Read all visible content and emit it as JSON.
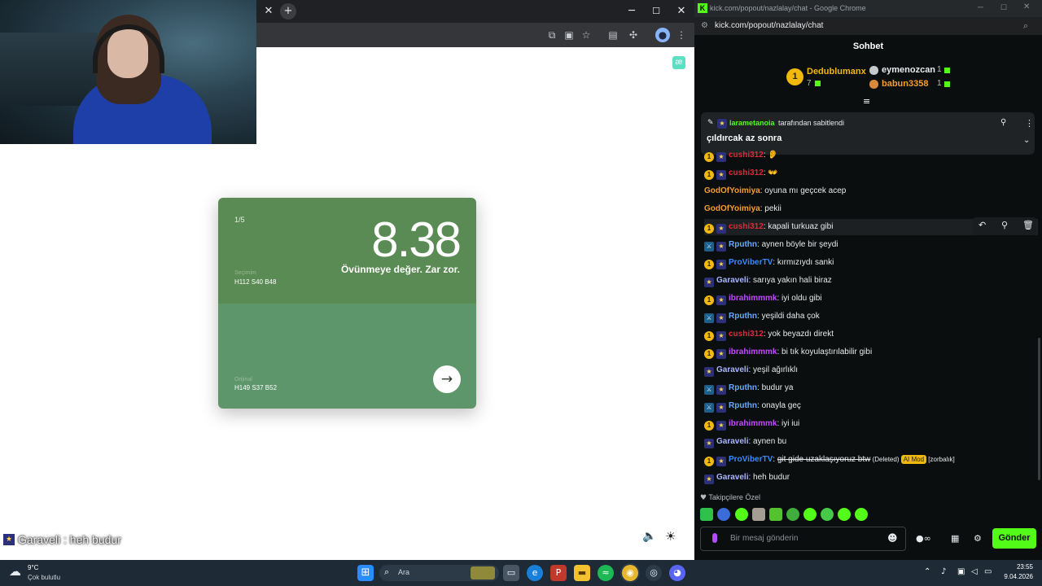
{
  "left_browser": {
    "tab_close": "✕",
    "new_tab": "+",
    "controls": {
      "minimize": "─",
      "maximize": "☐",
      "close": "✕"
    },
    "toolbar_icons": [
      "translate-icon",
      "screenshot-icon",
      "bookmark-star-icon",
      "reader-icon",
      "extensions-icon",
      "profile-icon",
      "menu-icon"
    ],
    "extension_badge": "æ"
  },
  "card": {
    "counter": "1/5",
    "score": "8.38",
    "remark": "Övünmeye değer. Zar zor.",
    "yours_label": "Seçimim",
    "yours_value": "H112 S40 B48",
    "original_label": "Orijinal",
    "original_value": "H149 S37 B52",
    "next_arrow": "→",
    "colors": {
      "top": "#5b8b54",
      "bottom": "#5c966a"
    }
  },
  "bottom_controls": {
    "sound_icon": "🔈",
    "theme_icon": "☀"
  },
  "overlay_caption": "Garaveli : heh budur",
  "chat_window": {
    "title": "kick.com/popout/nazlalay/chat - Google Chrome",
    "url": "kick.com/popout/nazlalay/chat",
    "header": "Sohbet",
    "leaderboard": {
      "first": {
        "rank": "1",
        "name": "Dedublumanx",
        "count": "7"
      },
      "second": {
        "name": "eymenozcan",
        "count": "1"
      },
      "third": {
        "name": "babun3358",
        "count": "1"
      }
    },
    "pinned": {
      "by_user": "larametanoia",
      "by_text": "tarafından sabitlendi",
      "message": "çıldırcak az sonra"
    },
    "messages": [
      {
        "badges": [
          "1",
          "star"
        ],
        "user": "cushi312",
        "color": "#e5273b",
        "text": "👂"
      },
      {
        "badges": [
          "1",
          "star"
        ],
        "user": "cushi312",
        "color": "#e5273b",
        "text": "👐"
      },
      {
        "badges": [],
        "user": "GodOfYoimiya",
        "color": "#f59e2d",
        "text": "oyuna mı geçcek acep"
      },
      {
        "badges": [],
        "user": "GodOfYoimiya",
        "color": "#f59e2d",
        "text": "pekii"
      },
      {
        "badges": [
          "1",
          "star"
        ],
        "user": "cushi312",
        "color": "#e5273b",
        "text": "kapali turkuaz gibi"
      },
      {
        "badges": [
          "mod",
          "star"
        ],
        "user": "Rputhn",
        "color": "#6aa8ff",
        "text": "aynen böyle bir şeydi"
      },
      {
        "badges": [
          "1",
          "star"
        ],
        "user": "ProViberTV",
        "color": "#3a8bff",
        "text": "kırmızıydı sanki"
      },
      {
        "badges": [
          "star"
        ],
        "user": "Garaveli",
        "color": "#aab6ff",
        "text": "sarıya yakın hali biraz"
      },
      {
        "badges": [
          "1",
          "star"
        ],
        "user": "ibrahimmmk",
        "color": "#c04bff",
        "text": "iyi oldu gibi"
      },
      {
        "badges": [
          "mod",
          "star"
        ],
        "user": "Rputhn",
        "color": "#6aa8ff",
        "text": "yeşildi daha çok"
      },
      {
        "badges": [
          "1",
          "star"
        ],
        "user": "cushi312",
        "color": "#e5273b",
        "text": "yok beyazdı direkt"
      },
      {
        "badges": [
          "1",
          "star"
        ],
        "user": "ibrahimmmk",
        "color": "#c04bff",
        "text": "bi tık koyulaştırılabilir gibi"
      },
      {
        "badges": [
          "star"
        ],
        "user": "Garaveli",
        "color": "#aab6ff",
        "text": "yeşil ağırlıklı"
      },
      {
        "badges": [
          "mod",
          "star"
        ],
        "user": "Rputhn",
        "color": "#6aa8ff",
        "text": "budur ya"
      },
      {
        "badges": [
          "mod",
          "star"
        ],
        "user": "Rputhn",
        "color": "#6aa8ff",
        "text": "onayla geç"
      },
      {
        "badges": [
          "1",
          "star"
        ],
        "user": "ibrahimmmk",
        "color": "#c04bff",
        "text": "iyi iui"
      },
      {
        "badges": [
          "star"
        ],
        "user": "Garaveli",
        "color": "#aab6ff",
        "text": "aynen bu"
      },
      {
        "badges": [
          "1",
          "star"
        ],
        "user": "ProViberTV",
        "color": "#3a8bff",
        "text": "git gide uzaklaşıyoruz btw",
        "deleted": "(Deleted)",
        "tag": "AI Mod",
        "reason": "[zorbalık]"
      },
      {
        "badges": [
          "star"
        ],
        "user": "Garaveli",
        "color": "#aab6ff",
        "text": "heh budur"
      }
    ],
    "emote_section_label": "Takipçilere Özel",
    "input_placeholder": "Bir mesaj gönderin",
    "send_button": "Gönder",
    "accent": "#53fc18"
  },
  "taskbar": {
    "weather_temp": "9°C",
    "weather_desc": "Çok bulutlu",
    "search_label": "Ara",
    "time": "23:55",
    "date": "9.04.2026"
  }
}
